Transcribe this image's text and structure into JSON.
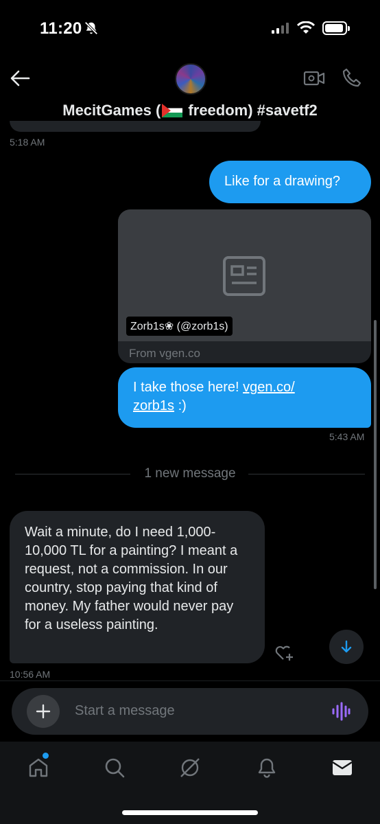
{
  "status_bar": {
    "time": "11:20"
  },
  "header": {
    "title_prefix": "MecitGames (",
    "title_suffix": " freedom) #savetf2"
  },
  "messages": {
    "prev_time": "5:18 AM",
    "outgoing_1": "Like for a drawing?",
    "card": {
      "tag": "Zorb1s❀ (@zorb1s)",
      "from": "From vgen.co"
    },
    "outgoing_2_text": "I take those here! ",
    "outgoing_2_link_1": "vgen.co/",
    "outgoing_2_link_2": "zorb1s",
    "outgoing_2_end": " :)",
    "outgoing_time": "5:43 AM",
    "divider": "1 new message",
    "incoming_text": "Wait a minute, do I need 1,000-10,000 TL for a painting? I meant a request, not a commission. In our country, stop paying that kind of money. My father would never pay for a useless painting.",
    "incoming_time": "10:56 AM"
  },
  "composer": {
    "placeholder": "Start a message"
  },
  "colors": {
    "accent": "#1d9bf0",
    "voice": "#9b6bff",
    "bubble_in": "#202327",
    "background": "#000000"
  },
  "icons": [
    "back-arrow-icon",
    "video-call-icon",
    "phone-call-icon",
    "article-icon",
    "add-reaction-icon",
    "arrow-down-icon",
    "plus-icon",
    "voice-icon",
    "home-icon",
    "search-icon",
    "grok-icon",
    "bell-icon",
    "mail-icon"
  ]
}
